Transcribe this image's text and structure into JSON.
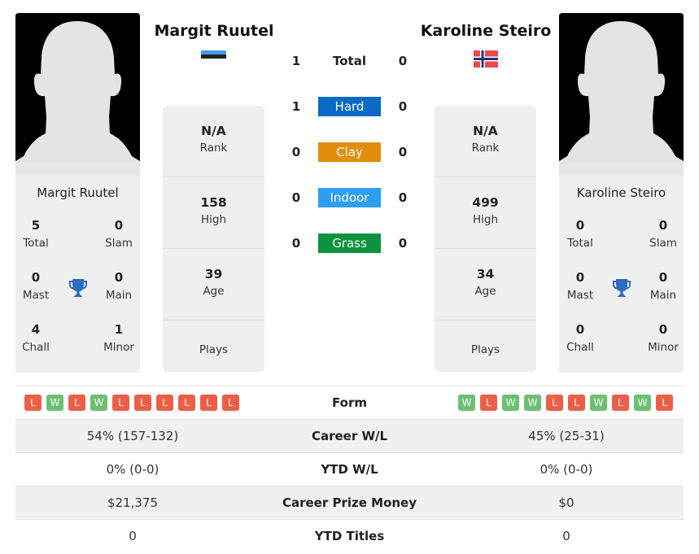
{
  "player_left": {
    "name": "Margit Ruutel",
    "country_flag": "estonia-flag",
    "titles": {
      "total": "5",
      "slam": "0",
      "mast": "0",
      "main": "0",
      "chall": "4",
      "minor": "1"
    },
    "rank": "N/A",
    "high": "158",
    "age": "39",
    "plays": ""
  },
  "player_right": {
    "name": "Karoline Steiro",
    "country_flag": "norway-flag",
    "titles": {
      "total": "0",
      "slam": "0",
      "mast": "0",
      "main": "0",
      "chall": "0",
      "minor": "0"
    },
    "rank": "N/A",
    "high": "499",
    "age": "34",
    "plays": ""
  },
  "labels": {
    "total": "Total",
    "slam": "Slam",
    "mast": "Mast",
    "main": "Main",
    "chall": "Chall",
    "minor": "Minor",
    "rank": "Rank",
    "high": "High",
    "age": "Age",
    "plays": "Plays"
  },
  "h2h": [
    {
      "label": "Total",
      "left": "1",
      "right": "0",
      "color": null
    },
    {
      "label": "Hard",
      "left": "1",
      "right": "0",
      "color": "#0a6ac4"
    },
    {
      "label": "Clay",
      "left": "0",
      "right": "0",
      "color": "#e08e0b"
    },
    {
      "label": "Indoor",
      "left": "0",
      "right": "0",
      "color": "#2e9ef0"
    },
    {
      "label": "Grass",
      "left": "0",
      "right": "0",
      "color": "#0d9340"
    }
  ],
  "form": {
    "label": "Form",
    "left": [
      "L",
      "W",
      "L",
      "W",
      "L",
      "L",
      "L",
      "L",
      "L",
      "L"
    ],
    "right": [
      "W",
      "L",
      "W",
      "W",
      "L",
      "L",
      "W",
      "L",
      "W",
      "L"
    ]
  },
  "stats": [
    {
      "label": "Career W/L",
      "left": "54% (157-132)",
      "right": "45% (25-31)"
    },
    {
      "label": "YTD W/L",
      "left": "0% (0-0)",
      "right": "0% (0-0)"
    },
    {
      "label": "Career Prize Money",
      "left": "$21,375",
      "right": "$0"
    },
    {
      "label": "YTD Titles",
      "left": "0",
      "right": "0"
    }
  ],
  "colors": {
    "win": "#6dbf73",
    "loss": "#ec5f47",
    "trophy": "#2f6bc0"
  }
}
